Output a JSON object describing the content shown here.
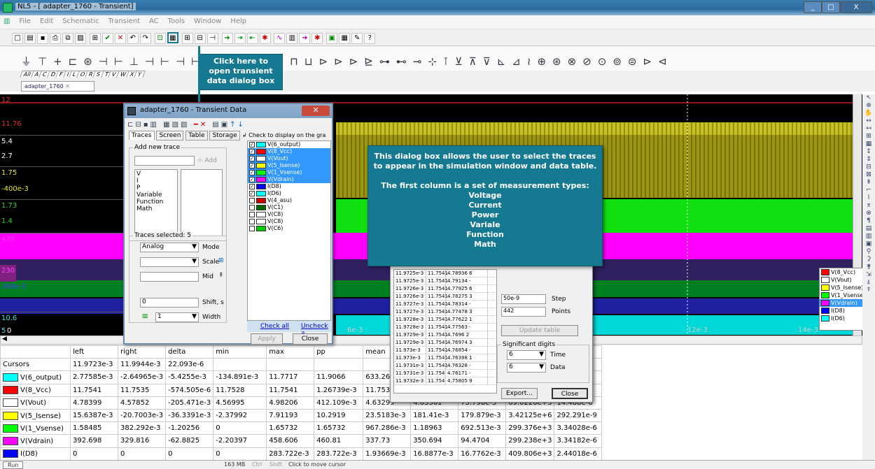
{
  "window": {
    "title": "NL5 - [ adapter_1760 - Transient]",
    "min": "_",
    "max": "□",
    "close": "X"
  },
  "menu": [
    "File",
    "Edit",
    "Schematic",
    "Transient",
    "AC",
    "Tools",
    "Window",
    "Help"
  ],
  "comp_tabs": [
    "All",
    "A",
    "C",
    "D",
    "F",
    "I",
    "L",
    "O",
    "R",
    "S",
    "T",
    "V",
    "W",
    "X",
    "Y"
  ],
  "doc_tab": "adapter_1760",
  "callout1": "Click here to open transient data dialog box",
  "callout2": {
    "lines": [
      "This dialog box allows the user to select the traces",
      "to appear in the simulation window and data table."
    ],
    "lines2": [
      "The first column is a set of measurement types:"
    ],
    "types": [
      "Voltage",
      "Current",
      "Power",
      "Variale",
      "Function",
      "Math"
    ]
  },
  "plot": {
    "labels": [
      {
        "v": "12",
        "c": "#e03030"
      },
      {
        "v": "11.76",
        "c": "#e03030"
      },
      {
        "v": "5.4",
        "c": "#ffffff"
      },
      {
        "v": "2.7",
        "c": "#ffffff"
      },
      {
        "v": "1.75",
        "c": "#e8e830"
      },
      {
        "v": "-400e-3",
        "c": "#e8e830"
      },
      {
        "v": "1.73",
        "c": "#30d030"
      },
      {
        "v": "1.4",
        "c": "#30d030"
      },
      {
        "v": "470",
        "c": "#ff40ff"
      },
      {
        "v": "230",
        "c": "#ff40ff"
      },
      {
        "v": "349e-3",
        "c": "#4040ff"
      },
      {
        "v": "10.6",
        "c": "#40e0e0"
      },
      {
        "v": "5",
        "c": "#40e0e0"
      },
      {
        "v": "0",
        "c": "#ffffff"
      }
    ],
    "x_ticks": [
      "6e-3",
      "12e-3",
      "14e-3"
    ]
  },
  "dialog": {
    "title": "adapter_1760 - Transient Data",
    "tabs": [
      "Traces",
      "Screen",
      "Table",
      "Storage"
    ],
    "add_new_trace": "Add new trace",
    "add_btn": "Add",
    "types": [
      "V",
      "I",
      "P",
      "Variable",
      "Function",
      "Math"
    ],
    "traces_selected": "Traces selected: 5",
    "mode_value": "Analog",
    "mode_label": "Mode",
    "scale_label": "Scale",
    "mid_label": "Mid",
    "shift_value": "0",
    "shift_label": "Shift, s",
    "width_value": "1",
    "width_label": "Width",
    "check_hdr": "Check to display on the gra",
    "traces": [
      {
        "n": "V(6_output)",
        "c": "#00ffff",
        "chk": true,
        "sel": false
      },
      {
        "n": "V(8_Vcc)",
        "c": "#ff0000",
        "chk": true,
        "sel": true
      },
      {
        "n": "V(Vout)",
        "c": "#ffffff",
        "chk": true,
        "sel": true
      },
      {
        "n": "V(5_Isense)",
        "c": "#ffff00",
        "chk": true,
        "sel": true
      },
      {
        "n": "V(1_Vsense)",
        "c": "#00ff00",
        "chk": true,
        "sel": true
      },
      {
        "n": "V(Vdrain)",
        "c": "#ff00ff",
        "chk": true,
        "sel": true
      },
      {
        "n": "I(D8)",
        "c": "#0000ff",
        "chk": true,
        "sel": false
      },
      {
        "n": "I(D6)",
        "c": "#00ffff",
        "chk": true,
        "sel": false
      },
      {
        "n": "V(4_asu)",
        "c": "#cc0000",
        "chk": false,
        "sel": false
      },
      {
        "n": "V(C1)",
        "c": "#006600",
        "chk": false,
        "sel": false
      },
      {
        "n": "V(C8)",
        "c": "#ffffff",
        "chk": false,
        "sel": false
      },
      {
        "n": "V(C8)",
        "c": "#ffffff",
        "chk": false,
        "sel": false
      },
      {
        "n": "V(C6)",
        "c": "#00cc00",
        "chk": false,
        "sel": false
      }
    ],
    "check_all": "Check all",
    "uncheck_all": "Uncheck a",
    "apply": "Apply",
    "close": "Close"
  },
  "table_dialog": {
    "rows": [
      [
        "11.9725e-3",
        "11.7541",
        "4.78936 6"
      ],
      [
        "11.9725e-3",
        "11.7541",
        "4.79134 -"
      ],
      [
        "11.9726e-3",
        "11.7541",
        "4.77925 6"
      ],
      [
        "11.9726e-3",
        "11.7541",
        "4.78275 3"
      ],
      [
        "11.9727e-3",
        "11.7541",
        "4.78314 -"
      ],
      [
        "11.9727e-3",
        "11.7541",
        "4.77478 3"
      ],
      [
        "11.9728e-3",
        "11.7541",
        "4.77622 1"
      ],
      [
        "11.9728e-3",
        "11.7541",
        "4.77563 -"
      ],
      [
        "11.9729e-3",
        "11.7541",
        "4.7696  2"
      ],
      [
        "11.9729e-3",
        "11.7541",
        "4.76974 3"
      ],
      [
        "11.973e-3",
        "11.7541",
        "4.76854 -"
      ],
      [
        "11.973e-3",
        "11.7541",
        "4.76398 1"
      ],
      [
        "11.9731e-3",
        "11.7541",
        "4.76328 -"
      ],
      [
        "11.9731e-3",
        "11.754",
        "4.76171 -"
      ],
      [
        "11.9732e-3",
        "11.754",
        "4.75805 9"
      ]
    ],
    "step_value": "50e-9",
    "step_label": "Step",
    "points_value": "442",
    "points_label": "Points",
    "update": "Update table",
    "sig_digits": "Significant digits",
    "time_value": "6",
    "time_label": "Time",
    "data_value": "6",
    "data_label": "Data",
    "export": "Export...",
    "close": "Close"
  },
  "legend": [
    {
      "n": "V(8_Vcc)",
      "c": "#ff0000"
    },
    {
      "n": "V(Vout)",
      "c": "#ffffff"
    },
    {
      "n": "V(5_Isense)",
      "c": "#ffff00"
    },
    {
      "n": "V(1_Vsense)",
      "c": "#00ff00"
    },
    {
      "n": "V(Vdrain)",
      "c": "#ff00ff",
      "sel": true
    },
    {
      "n": "I(D8)",
      "c": "#0000ff"
    },
    {
      "n": "I(D6)",
      "c": "#00ffff"
    }
  ],
  "table": {
    "headers": [
      "",
      "left",
      "right",
      "delta",
      "min",
      "max",
      "pp",
      "mean",
      "",
      "",
      "",
      ""
    ],
    "rows": [
      {
        "name": "Cursors",
        "c": "",
        "v": [
          "11.9723e-3",
          "11.9944e-3",
          "22.093e-6",
          "",
          "",
          "",
          "",
          "",
          "",
          "",
          ""
        ]
      },
      {
        "name": "V(6_output)",
        "c": "#00ffff",
        "v": [
          "2.77585e-3",
          "-2.64965e-3",
          "-5.4255e-3",
          "-134.891e-3",
          "11.7717",
          "11.9066",
          "633.26e",
          "",
          "",
          "",
          ""
        ]
      },
      {
        "name": "V(8_Vcc)",
        "c": "#ff0000",
        "v": [
          "11.7541",
          "11.7535",
          "-574.505e-6",
          "11.7528",
          "11.7541",
          "1.26739e-3",
          "11.7537",
          "",
          "",
          "",
          ""
        ]
      },
      {
        "name": "V(Vout)",
        "c": "#ffffff",
        "v": [
          "4.78399",
          "4.57852",
          "-205.471e-3",
          "4.56995",
          "4.98206",
          "412.109e-3",
          "4.63299",
          "4.63361",
          "75.798e-3",
          "69.0226e+3",
          "14.488e-6"
        ]
      },
      {
        "name": "V(5_Isense)",
        "c": "#ffff00",
        "v": [
          "15.6387e-3",
          "-20.7003e-3",
          "-36.3391e-3",
          "-2.37992",
          "7.91193",
          "10.2919",
          "23.5183e-3",
          "181.41e-3",
          "179.879e-3",
          "3.42125e+6",
          "292.291e-9"
        ]
      },
      {
        "name": "V(1_Vsense)",
        "c": "#00ff00",
        "v": [
          "1.58485",
          "382.292e-3",
          "-1.20256",
          "0",
          "1.65732",
          "1.65732",
          "967.286e-3",
          "1.18963",
          "692.513e-3",
          "299.376e+3",
          "3.34028e-6"
        ]
      },
      {
        "name": "V(Vdrain)",
        "c": "#ff00ff",
        "v": [
          "392.698",
          "329.816",
          "-62.8825",
          "-2.20397",
          "458.606",
          "460.81",
          "337.73",
          "350.694",
          "94.4704",
          "299.238e+3",
          "3.34182e-6"
        ]
      },
      {
        "name": "I(D8)",
        "c": "#0000ff",
        "v": [
          "0",
          "0",
          "0",
          "0",
          "283.722e-3",
          "283.722e-3",
          "1.93669e-3",
          "16.8877e-3",
          "16.7762e-3",
          "409.806e+3",
          "2.44018e-6"
        ]
      }
    ]
  },
  "status": {
    "tab": "Run",
    "mem": "163 MB",
    "ctrl": "Ctrl",
    "shift": "Shift",
    "msg": "Click to move cursor"
  },
  "colors": {
    "accent": "#157a91",
    "plot_bg": "#000000"
  }
}
